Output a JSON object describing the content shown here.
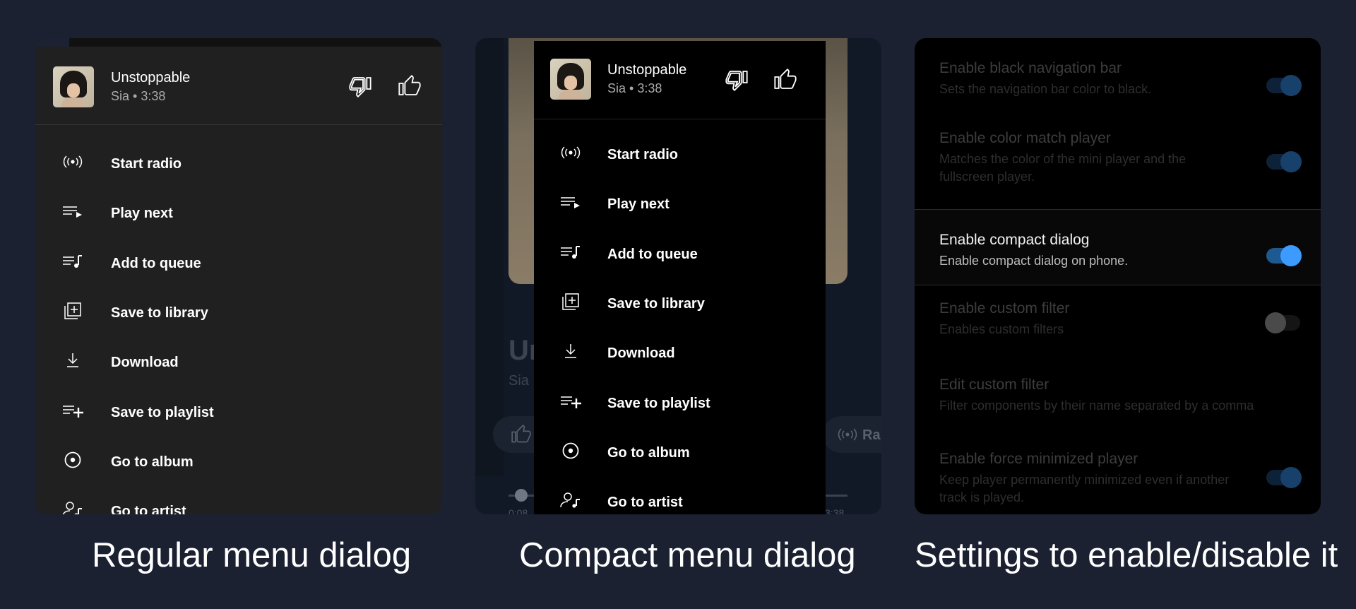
{
  "captions": {
    "regular": "Regular menu dialog",
    "compact": "Compact menu dialog",
    "settings": "Settings to enable/disable it"
  },
  "song": {
    "title": "Unstoppable",
    "subtitle": "Sia • 3:38"
  },
  "menu_items": [
    {
      "label": "Start radio",
      "icon": "radio-icon"
    },
    {
      "label": "Play next",
      "icon": "play-next-icon"
    },
    {
      "label": "Add to queue",
      "icon": "queue-music-icon"
    },
    {
      "label": "Save to library",
      "icon": "library-add-icon"
    },
    {
      "label": "Download",
      "icon": "download-icon"
    },
    {
      "label": "Save to playlist",
      "icon": "playlist-add-icon"
    },
    {
      "label": "Go to album",
      "icon": "album-icon"
    },
    {
      "label": "Go to artist",
      "icon": "artist-icon"
    }
  ],
  "background_player": {
    "title_fragment": "Ur",
    "artist_fragment": "Sia",
    "radio_fragment": "Ra",
    "time_elapsed": "0:08",
    "time_total": "3:38"
  },
  "settings": [
    {
      "title": "Enable black navigation bar",
      "subtitle": "Sets the navigation bar color to black.",
      "state": "on",
      "highlighted": false
    },
    {
      "title": "Enable color match player",
      "subtitle": "Matches the color of the mini player and the fullscreen player.",
      "state": "on",
      "highlighted": false
    },
    {
      "title": "Enable compact dialog",
      "subtitle": "Enable compact dialog on phone.",
      "state": "on",
      "highlighted": true
    },
    {
      "title": "Enable custom filter",
      "subtitle": "Enables custom filters",
      "state": "off",
      "highlighted": false
    },
    {
      "title": "Edit custom filter",
      "subtitle": "Filter components by their name separated by a comma",
      "state": "none",
      "highlighted": false
    },
    {
      "title": "Enable force minimized player",
      "subtitle": "Keep player permanently minimized even if another track is played.",
      "state": "on",
      "highlighted": false
    }
  ],
  "colors": {
    "page_bg": "#1b2131",
    "toggle_on_accent": "#3d9bff",
    "sheet_regular": "#202020",
    "sheet_compact": "#000000"
  }
}
